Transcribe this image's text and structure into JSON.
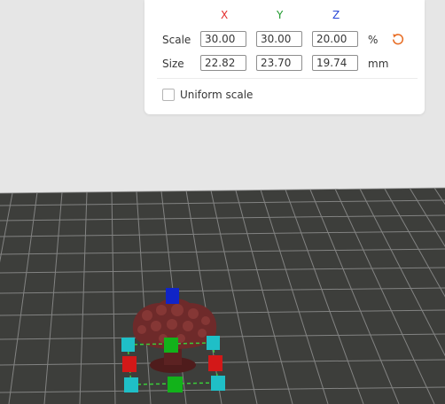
{
  "scale_panel": {
    "axes": {
      "x": "X",
      "y": "Y",
      "z": "Z"
    },
    "axis_colors": {
      "x": "#e32d2d",
      "y": "#1f9a2d",
      "z": "#2746d6"
    },
    "scale": {
      "label": "Scale",
      "x": "30.00",
      "y": "30.00",
      "z": "20.00",
      "unit": "%"
    },
    "size": {
      "label": "Size",
      "x": "22.82",
      "y": "23.70",
      "z": "19.74",
      "unit": "mm"
    },
    "reset_icon": "reset-rotate-icon",
    "reset_color": "#e86e26",
    "uniform_scale": {
      "label": "Uniform scale",
      "checked": false
    }
  },
  "viewport": {
    "bed_color": "#3d3e3b",
    "grid_color": "#9a9a9a",
    "model_color": "#6e2a2a",
    "handles": {
      "corner_color": "#1fbfc7",
      "x_handle_color": "#d31818",
      "y_handle_color": "#12b21a",
      "z_handle_color": "#1024c8",
      "bbox_color": "#3acd3a"
    }
  }
}
